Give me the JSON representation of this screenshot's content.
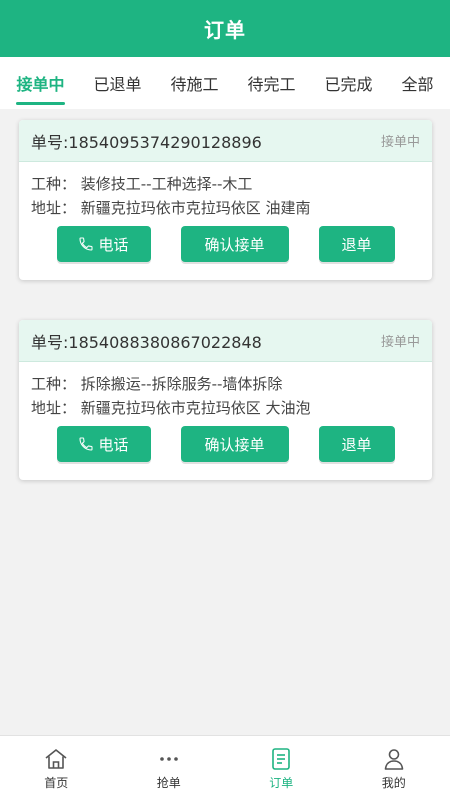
{
  "header": {
    "title": "订单"
  },
  "tabs": [
    {
      "label": "接单中",
      "active": true
    },
    {
      "label": "已退单"
    },
    {
      "label": "待施工"
    },
    {
      "label": "待完工"
    },
    {
      "label": "已完成"
    },
    {
      "label": "全部"
    }
  ],
  "orders": [
    {
      "order_no": "单号:1854095374290128896",
      "status": "接单中",
      "work_type": "工种：  装修技工--工种选择--木工",
      "address": "地址：  新疆克拉玛依市克拉玛依区 油建南",
      "buttons": {
        "call": "电话",
        "confirm": "确认接单",
        "cancel": "退单"
      }
    },
    {
      "order_no": "单号:1854088380867022848",
      "status": "接单中",
      "work_type": "工种：  拆除搬运--拆除服务--墙体拆除",
      "address": "地址：  新疆克拉玛依市克拉玛依区 大油泡",
      "buttons": {
        "call": "电话",
        "confirm": "确认接单",
        "cancel": "退单"
      }
    }
  ],
  "bottom_nav": [
    {
      "label": "首页",
      "icon": "home-icon"
    },
    {
      "label": "抢单",
      "icon": "more-dots-icon"
    },
    {
      "label": "订单",
      "icon": "order-list-icon",
      "active": true
    },
    {
      "label": "我的",
      "icon": "user-icon"
    }
  ],
  "colors": {
    "accent": "#1eb482",
    "card_head": "#e6f7f0",
    "background": "#f2f2f2"
  }
}
